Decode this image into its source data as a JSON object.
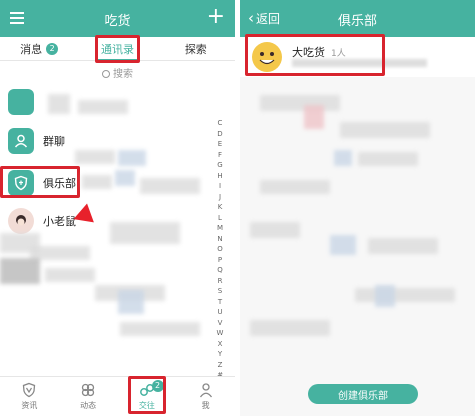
{
  "left": {
    "header": {
      "title": "吃货"
    },
    "tabs": [
      {
        "label": "消息",
        "badge": "2"
      },
      {
        "label": "通讯录"
      },
      {
        "label": "探索"
      }
    ],
    "search": {
      "placeholder": "搜索"
    },
    "contacts": [
      {
        "label": "群聊"
      },
      {
        "label": "俱乐部"
      },
      {
        "label": "小老鼠"
      }
    ],
    "index_letters": [
      "C",
      "D",
      "E",
      "F",
      "G",
      "H",
      "I",
      "J",
      "K",
      "L",
      "M",
      "N",
      "O",
      "P",
      "Q",
      "R",
      "S",
      "T",
      "U",
      "V",
      "W",
      "X",
      "Y",
      "Z",
      "#"
    ],
    "bottom_nav": [
      {
        "label": "资讯",
        "icon": "shield-icon"
      },
      {
        "label": "动态",
        "icon": "clover-icon"
      },
      {
        "label": "交往",
        "icon": "chat-link-icon",
        "badge": "2"
      },
      {
        "label": "我",
        "icon": "person-icon"
      }
    ]
  },
  "right": {
    "header": {
      "back_label": "返回",
      "title": "俱乐部"
    },
    "club": {
      "name": "大吃货",
      "member_count": "1人"
    },
    "create_button": "创建俱乐部"
  },
  "colors": {
    "accent": "#46b2a0",
    "highlight": "#d8242e"
  }
}
